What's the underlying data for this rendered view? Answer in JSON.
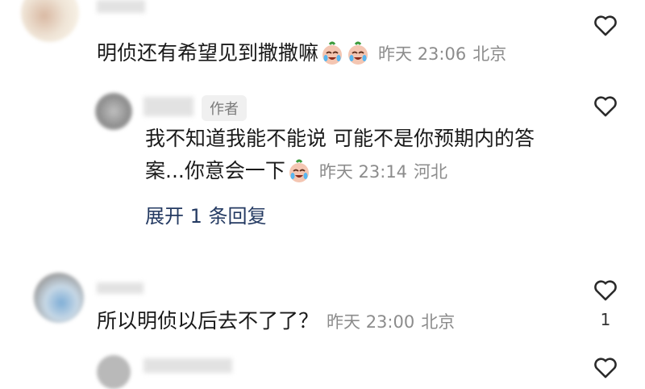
{
  "comments": [
    {
      "text": "明侦还有希望见到撒撒嘛",
      "emojis": [
        "cry-laugh-icon",
        "cry-laugh-icon"
      ],
      "time": "昨天 23:06",
      "location": "北京"
    },
    {
      "tag": "作者",
      "text_line1": "我不知道我能不能说 可能不是你预期内的答",
      "text_line2": "案...你意会一下",
      "emojis": [
        "cry-laugh-icon"
      ],
      "time": "昨天 23:14",
      "location": "河北",
      "expand_label": "展开 1 条回复"
    },
    {
      "text": "所以明侦以后去不了了？",
      "time": "昨天 23:00",
      "location": "北京",
      "like_count": "1"
    }
  ],
  "colors": {
    "meta": "#8c8c8c",
    "expand": "#243a62",
    "tag_bg": "#f0f0f0"
  }
}
